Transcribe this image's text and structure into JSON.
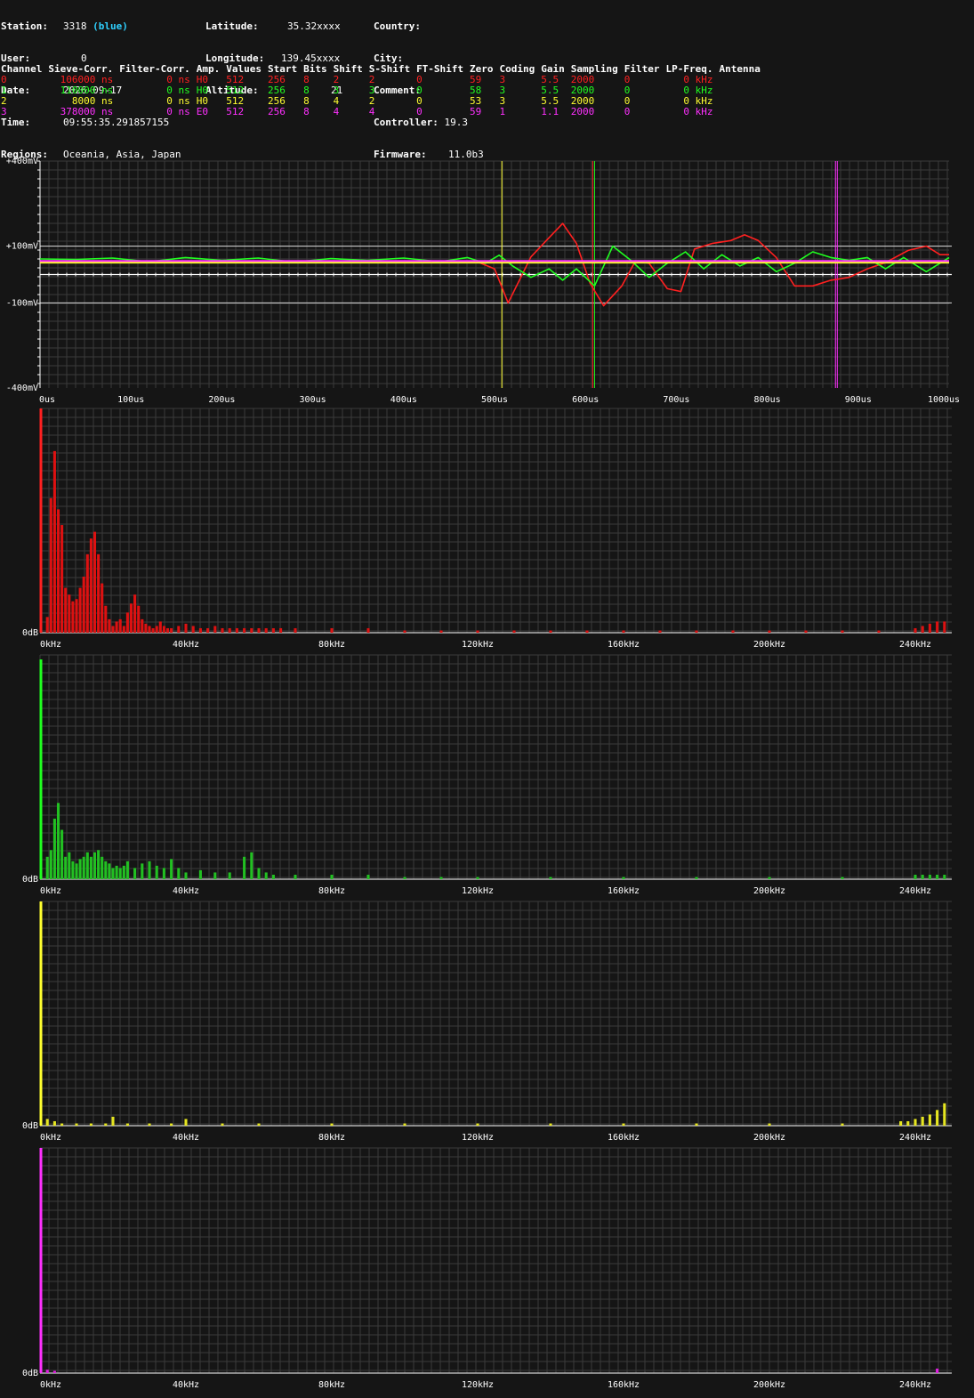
{
  "station": {
    "station_label": "Station:",
    "station": "3318",
    "station_tag": "(blue)",
    "user_label": "User:",
    "user": "0",
    "date_label": "Date:",
    "date": "2026-09-17",
    "time_label": "Time:",
    "time": "09:55:35.291857155",
    "regions_label": "Regions:",
    "regions": "Oceania, Asia, Japan",
    "latitude_label": "Latitude:",
    "latitude": "35.32xxxx",
    "longitude_label": "Longitude:",
    "longitude": "139.45xxxx",
    "altitude_label": "Altitude:",
    "altitude": "21",
    "country_label": "Country:",
    "country": "",
    "city_label": "City:",
    "city": "",
    "comment_label": "Comment:",
    "comment": "",
    "controller_label": "Controller:",
    "controller": "19.3",
    "firmware_label": "Firmware:",
    "firmware": "11.0b3"
  },
  "channel_table": {
    "headers": [
      "Channel",
      "Sieve-Corr.",
      "Filter-Corr.",
      "Amp.",
      "Values",
      "Start",
      "Bits",
      "Shift",
      "S-Shift",
      "FT-Shift",
      "Zero",
      "Coding",
      "Gain",
      "Sampling",
      "Filter",
      "LP-Freq.",
      "Antenna"
    ],
    "rows": [
      {
        "color": "#ff2020",
        "cells": [
          "0",
          "106000 ns",
          "0 ns",
          "H0",
          "512",
          "256",
          "8",
          "2",
          "2",
          "0",
          "59",
          "3",
          "5.5",
          "2000",
          "0",
          "0 kHz",
          ""
        ]
      },
      {
        "color": "#20ff20",
        "cells": [
          "1",
          "110000 ns",
          "0 ns",
          "H0",
          "512",
          "256",
          "8",
          "3",
          "3",
          "0",
          "58",
          "3",
          "5.5",
          "2000",
          "0",
          "0 kHz",
          ""
        ]
      },
      {
        "color": "#ffff30",
        "cells": [
          "2",
          "8000 ns",
          "0 ns",
          "H0",
          "512",
          "256",
          "8",
          "4",
          "2",
          "0",
          "53",
          "3",
          "5.5",
          "2000",
          "0",
          "0 kHz",
          ""
        ]
      },
      {
        "color": "#ff30ff",
        "cells": [
          "3",
          "378000 ns",
          "0 ns",
          "E0",
          "512",
          "256",
          "8",
          "4",
          "4",
          "0",
          "59",
          "1",
          "1.1",
          "2000",
          "0",
          "0 kHz",
          ""
        ]
      }
    ]
  },
  "chart_data": [
    {
      "type": "line",
      "x_unit": "us",
      "xlim": [
        0,
        1000
      ],
      "ylim": [
        -400,
        400
      ],
      "y_tick_labels": [
        "+400mV",
        "+100mV",
        "-100mV",
        "-400mV"
      ],
      "x_tick_labels": [
        "0us",
        "100us",
        "200us",
        "300us",
        "400us",
        "500us",
        "600us",
        "700us",
        "800us",
        "900us",
        "1000us"
      ],
      "markers": [
        {
          "x": 508,
          "color": "#ffff30"
        },
        {
          "x": 608,
          "color": "#ff2020"
        },
        {
          "x": 610,
          "color": "#20ff20"
        },
        {
          "x": 875,
          "color": "#ff30ff"
        },
        {
          "x": 877,
          "color": "#ff30ff"
        }
      ],
      "series": [
        {
          "color": "#ff2020",
          "x": [
            0,
            100,
            200,
            300,
            400,
            480,
            500,
            515,
            540,
            560,
            575,
            590,
            605,
            620,
            640,
            655,
            670,
            690,
            705,
            720,
            740,
            760,
            775,
            790,
            810,
            830,
            850,
            870,
            890,
            910,
            930,
            955,
            975,
            990,
            1000
          ],
          "y": [
            47,
            47,
            46,
            48,
            47,
            46,
            20,
            -100,
            62,
            130,
            180,
            110,
            -30,
            -110,
            -40,
            48,
            40,
            -50,
            -60,
            90,
            110,
            120,
            140,
            120,
            60,
            -40,
            -40,
            -20,
            -10,
            20,
            42,
            85,
            100,
            70,
            70
          ]
        },
        {
          "color": "#20ff20",
          "x": [
            0,
            40,
            80,
            120,
            160,
            200,
            240,
            280,
            320,
            360,
            400,
            440,
            470,
            490,
            505,
            520,
            540,
            560,
            575,
            590,
            610,
            630,
            650,
            670,
            690,
            710,
            730,
            750,
            770,
            790,
            810,
            830,
            850,
            870,
            890,
            910,
            930,
            950,
            975,
            1000
          ],
          "y": [
            55,
            53,
            58,
            45,
            60,
            50,
            58,
            44,
            56,
            50,
            58,
            45,
            60,
            40,
            68,
            30,
            -10,
            20,
            -20,
            20,
            -40,
            100,
            50,
            -10,
            40,
            80,
            20,
            70,
            30,
            60,
            10,
            40,
            80,
            60,
            50,
            60,
            20,
            60,
            10,
            60
          ]
        },
        {
          "color": "#ffff30",
          "x": [
            0,
            100,
            200,
            300,
            400,
            500,
            600,
            700,
            800,
            900,
            1000
          ],
          "y": [
            42,
            42,
            42,
            42,
            42,
            42,
            42,
            42,
            42,
            42,
            42
          ]
        },
        {
          "color": "#ff30ff",
          "x": [
            0,
            100,
            200,
            300,
            400,
            500,
            600,
            700,
            800,
            900,
            1000
          ],
          "y": [
            48,
            48,
            48,
            48,
            48,
            48,
            48,
            48,
            48,
            48,
            48
          ]
        }
      ]
    },
    {
      "type": "bar",
      "color": "#dd1111",
      "line_color": "#ff2020",
      "x_unit": "kHz",
      "xlim": [
        0,
        250
      ],
      "y_label": "0dB",
      "x_tick_labels": [
        "0kHz",
        "40kHz",
        "80kHz",
        "120kHz",
        "160kHz",
        "200kHz",
        "240kHz"
      ],
      "x": [
        2,
        3,
        4,
        5,
        6,
        7,
        8,
        9,
        10,
        11,
        12,
        13,
        14,
        15,
        16,
        17,
        18,
        19,
        20,
        21,
        22,
        23,
        24,
        25,
        26,
        27,
        28,
        29,
        30,
        31,
        32,
        33,
        34,
        35,
        36,
        38,
        40,
        42,
        44,
        46,
        48,
        50,
        52,
        54,
        56,
        58,
        60,
        62,
        64,
        66,
        70,
        80,
        90,
        100,
        110,
        120,
        130,
        140,
        150,
        160,
        170,
        180,
        190,
        200,
        210,
        220,
        230,
        240,
        242,
        244,
        246,
        248
      ],
      "values": [
        0.07,
        0.6,
        0.81,
        0.55,
        0.48,
        0.2,
        0.17,
        0.14,
        0.15,
        0.2,
        0.25,
        0.35,
        0.42,
        0.45,
        0.35,
        0.22,
        0.12,
        0.06,
        0.03,
        0.05,
        0.06,
        0.03,
        0.09,
        0.13,
        0.17,
        0.12,
        0.06,
        0.04,
        0.03,
        0.02,
        0.03,
        0.05,
        0.03,
        0.02,
        0.02,
        0.03,
        0.04,
        0.03,
        0.02,
        0.02,
        0.03,
        0.02,
        0.02,
        0.02,
        0.02,
        0.02,
        0.02,
        0.02,
        0.02,
        0.02,
        0.02,
        0.02,
        0.02,
        0.01,
        0.01,
        0.01,
        0.01,
        0.01,
        0.01,
        0.01,
        0.01,
        0.01,
        0.01,
        0.01,
        0.01,
        0.01,
        0.01,
        0.02,
        0.03,
        0.04,
        0.05,
        0.05
      ],
      "dc_line": 1.0
    },
    {
      "type": "bar",
      "color": "#22c022",
      "line_color": "#20ff20",
      "x_unit": "kHz",
      "xlim": [
        0,
        250
      ],
      "y_label": "0dB",
      "x_tick_labels": [
        "0kHz",
        "40kHz",
        "80kHz",
        "120kHz",
        "160kHz",
        "200kHz",
        "240kHz"
      ],
      "x": [
        2,
        3,
        4,
        5,
        6,
        7,
        8,
        9,
        10,
        11,
        12,
        13,
        14,
        15,
        16,
        17,
        18,
        19,
        20,
        21,
        22,
        23,
        24,
        26,
        28,
        30,
        32,
        34,
        36,
        38,
        40,
        44,
        48,
        52,
        56,
        58,
        60,
        62,
        64,
        70,
        80,
        90,
        100,
        110,
        120,
        140,
        160,
        180,
        200,
        220,
        240,
        242,
        244,
        246,
        248
      ],
      "values": [
        0.1,
        0.13,
        0.27,
        0.34,
        0.22,
        0.1,
        0.12,
        0.08,
        0.07,
        0.09,
        0.1,
        0.12,
        0.1,
        0.12,
        0.13,
        0.1,
        0.08,
        0.07,
        0.05,
        0.06,
        0.05,
        0.06,
        0.08,
        0.05,
        0.07,
        0.08,
        0.06,
        0.05,
        0.09,
        0.05,
        0.03,
        0.04,
        0.03,
        0.03,
        0.1,
        0.12,
        0.05,
        0.03,
        0.02,
        0.02,
        0.02,
        0.02,
        0.01,
        0.01,
        0.01,
        0.01,
        0.01,
        0.01,
        0.01,
        0.01,
        0.02,
        0.02,
        0.02,
        0.02,
        0.02
      ],
      "dc_line": 0.98
    },
    {
      "type": "bar",
      "color": "#e6e620",
      "line_color": "#ffff30",
      "x_unit": "kHz",
      "xlim": [
        0,
        250
      ],
      "y_label": "0dB",
      "x_tick_labels": [
        "0kHz",
        "40kHz",
        "80kHz",
        "120kHz",
        "160kHz",
        "200kHz",
        "240kHz"
      ],
      "x": [
        2,
        4,
        6,
        10,
        14,
        18,
        20,
        24,
        30,
        36,
        40,
        50,
        60,
        80,
        100,
        120,
        140,
        160,
        180,
        200,
        220,
        236,
        238,
        240,
        242,
        244,
        246,
        248
      ],
      "values": [
        0.03,
        0.02,
        0.01,
        0.01,
        0.01,
        0.01,
        0.04,
        0.01,
        0.01,
        0.01,
        0.03,
        0.01,
        0.01,
        0.01,
        0.01,
        0.01,
        0.01,
        0.01,
        0.01,
        0.01,
        0.01,
        0.02,
        0.02,
        0.03,
        0.04,
        0.05,
        0.07,
        0.1
      ],
      "dc_line": 1.0
    },
    {
      "type": "bar",
      "color": "#e020e0",
      "line_color": "#ff30ff",
      "x_unit": "kHz",
      "xlim": [
        0,
        250
      ],
      "y_label": "0dB",
      "x_tick_labels": [
        "0kHz",
        "40kHz",
        "80kHz",
        "120kHz",
        "160kHz",
        "200kHz",
        "240kHz"
      ],
      "x": [
        2,
        4,
        246
      ],
      "values": [
        0.015,
        0.01,
        0.02
      ],
      "dc_line": 1.0
    }
  ]
}
